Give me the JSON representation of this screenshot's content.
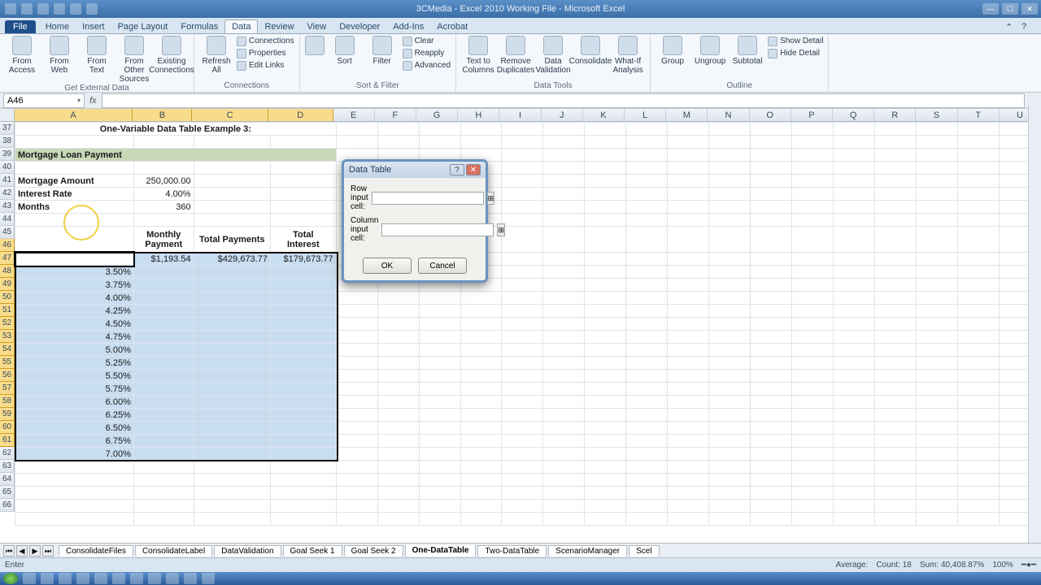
{
  "window": {
    "title": "3CMedia - Excel 2010 Working File - Microsoft Excel"
  },
  "tabs": {
    "file": "File",
    "list": [
      "Home",
      "Insert",
      "Page Layout",
      "Formulas",
      "Data",
      "Review",
      "View",
      "Developer",
      "Add-Ins",
      "Acrobat"
    ],
    "active": 4
  },
  "ribbon": {
    "ext": {
      "access": "From Access",
      "web": "From Web",
      "text": "From Text",
      "other": "From Other Sources",
      "existing": "Existing Connections",
      "label": "Get External Data"
    },
    "conn": {
      "refresh": "Refresh All",
      "connections": "Connections",
      "properties": "Properties",
      "editlinks": "Edit Links",
      "label": "Connections"
    },
    "sort": {
      "sort": "Sort",
      "filter": "Filter",
      "clear": "Clear",
      "reapply": "Reapply",
      "advanced": "Advanced",
      "label": "Sort & Filter"
    },
    "tools": {
      "t2c": "Text to Columns",
      "dup": "Remove Duplicates",
      "val": "Data Validation",
      "cons": "Consolidate",
      "whatif": "What-If Analysis",
      "label": "Data Tools"
    },
    "outline": {
      "group": "Group",
      "ungroup": "Ungroup",
      "subtotal": "Subtotal",
      "showd": "Show Detail",
      "hided": "Hide Detail",
      "label": "Outline"
    }
  },
  "namebox": "A46",
  "sheet": {
    "cols": [
      "A",
      "B",
      "C",
      "D",
      "E",
      "F",
      "G",
      "H",
      "I",
      "J",
      "K",
      "L",
      "M",
      "N",
      "O",
      "P",
      "Q",
      "R",
      "S",
      "T",
      "U"
    ],
    "rows": [
      37,
      38,
      39,
      40,
      41,
      42,
      43,
      44,
      45,
      46,
      47,
      48,
      49,
      50,
      51,
      52,
      53,
      54,
      55,
      56,
      57,
      58,
      59,
      60,
      61,
      62,
      63,
      64,
      65,
      66
    ],
    "title": "One-Variable Data Table Example 3:",
    "section": "Mortgage Loan Payment",
    "labels": {
      "ma": "Mortgage Amount",
      "ir": "Interest Rate",
      "mo": "Months"
    },
    "vals": {
      "ma": "250,000.00",
      "ir": "4.00%",
      "mo": "360"
    },
    "hdr": {
      "mp1": "Monthly",
      "mp2": "Payment",
      "tp": "Total Payments",
      "ti1": "Total",
      "ti2": "Interest"
    },
    "row46": {
      "b": "$1,193.54",
      "c": "$429,673.77",
      "d": "$179,673.77"
    },
    "rates": [
      "3.50%",
      "3.75%",
      "4.00%",
      "4.25%",
      "4.50%",
      "4.75%",
      "5.00%",
      "5.25%",
      "5.50%",
      "5.75%",
      "6.00%",
      "6.25%",
      "6.50%",
      "6.75%",
      "7.00%"
    ]
  },
  "dialog": {
    "title": "Data Table",
    "row": "Row input cell:",
    "col": "Column input cell:",
    "ok": "OK",
    "cancel": "Cancel"
  },
  "sheettabs": [
    "ConsolidateFiles",
    "ConsolidateLabel",
    "DataValidation",
    "Goal Seek 1",
    "Goal Seek 2",
    "One-DataTable",
    "Two-DataTable",
    "ScenarioManager",
    "Scel"
  ],
  "sheettab_active": 5,
  "status": {
    "left": "Enter",
    "avg": "Average:",
    "count": "Count: 18",
    "sum": "Sum: 40,408.87%",
    "zoom": "100%"
  }
}
